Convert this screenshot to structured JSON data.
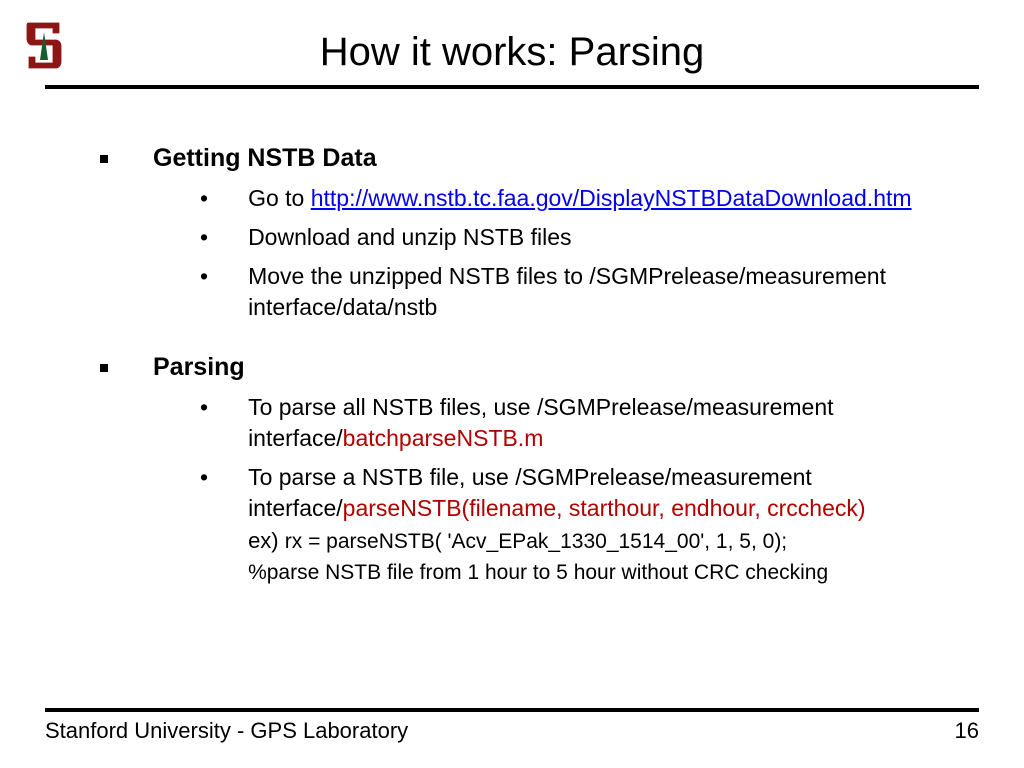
{
  "title": "How it works: Parsing",
  "sections": [
    {
      "heading": "Getting NSTB Data",
      "items": [
        {
          "pre": "Go to ",
          "link": "http://www.nstb.tc.faa.gov/DisplayNSTBDataDownload.htm"
        },
        {
          "text": "Download and unzip NSTB files"
        },
        {
          "text": "Move the unzipped NSTB files to /SGMPrelease/measurement interface/data/nstb"
        }
      ]
    },
    {
      "heading": "Parsing",
      "items": [
        {
          "pre": "To parse all NSTB files, use /SGMPrelease/measurement interface/",
          "red": "batchparseNSTB.m"
        },
        {
          "pre": "To parse a NSTB file, use /SGMPrelease/measurement interface/",
          "red": "parseNSTB(filename, starthour, endhour, crccheck)",
          "ex_label": "ex) ",
          "ex_code": "rx = parseNSTB( 'Acv_EPak_1330_1514_00', 1, 5, 0);",
          "comment": "%parse NSTB file from 1 hour to 5 hour without CRC checking"
        }
      ]
    }
  ],
  "footer": {
    "left": "Stanford University - GPS Laboratory",
    "right": "16"
  }
}
